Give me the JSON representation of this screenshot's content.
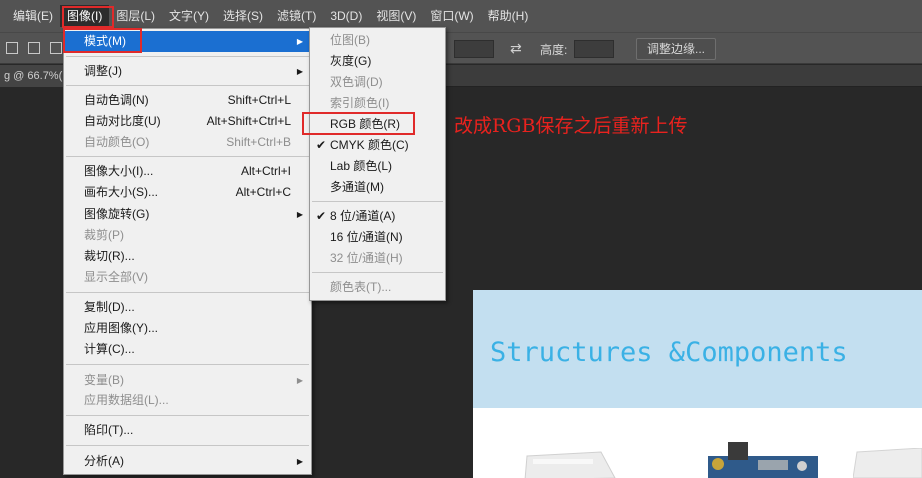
{
  "menubar": {
    "items": [
      "编辑(E)",
      "图像(I)",
      "图层(L)",
      "文字(Y)",
      "选择(S)",
      "滤镜(T)",
      "3D(D)",
      "视图(V)",
      "窗口(W)",
      "帮助(H)"
    ],
    "active_index": 1
  },
  "options_bar": {
    "height_label": "高度:",
    "refine_edge_button": "调整边缘..."
  },
  "document_tab": {
    "label": "g @ 66.7%("
  },
  "image_menu": {
    "items": [
      {
        "type": "item",
        "label": "模式(M)",
        "shortcut": "",
        "submenu": true,
        "disabled": false,
        "highlighted": true
      },
      {
        "type": "sep"
      },
      {
        "type": "item",
        "label": "调整(J)",
        "shortcut": "",
        "submenu": true,
        "disabled": false
      },
      {
        "type": "sep"
      },
      {
        "type": "item",
        "label": "自动色调(N)",
        "shortcut": "Shift+Ctrl+L",
        "submenu": false,
        "disabled": false
      },
      {
        "type": "item",
        "label": "自动对比度(U)",
        "shortcut": "Alt+Shift+Ctrl+L",
        "submenu": false,
        "disabled": false
      },
      {
        "type": "item",
        "label": "自动颜色(O)",
        "shortcut": "Shift+Ctrl+B",
        "submenu": false,
        "disabled": true
      },
      {
        "type": "sep"
      },
      {
        "type": "item",
        "label": "图像大小(I)...",
        "shortcut": "Alt+Ctrl+I",
        "submenu": false,
        "disabled": false
      },
      {
        "type": "item",
        "label": "画布大小(S)...",
        "shortcut": "Alt+Ctrl+C",
        "submenu": false,
        "disabled": false
      },
      {
        "type": "item",
        "label": "图像旋转(G)",
        "shortcut": "",
        "submenu": true,
        "disabled": false
      },
      {
        "type": "item",
        "label": "裁剪(P)",
        "shortcut": "",
        "submenu": false,
        "disabled": true
      },
      {
        "type": "item",
        "label": "裁切(R)...",
        "shortcut": "",
        "submenu": false,
        "disabled": false
      },
      {
        "type": "item",
        "label": "显示全部(V)",
        "shortcut": "",
        "submenu": false,
        "disabled": true
      },
      {
        "type": "sep"
      },
      {
        "type": "item",
        "label": "复制(D)...",
        "shortcut": "",
        "submenu": false,
        "disabled": false
      },
      {
        "type": "item",
        "label": "应用图像(Y)...",
        "shortcut": "",
        "submenu": false,
        "disabled": false
      },
      {
        "type": "item",
        "label": "计算(C)...",
        "shortcut": "",
        "submenu": false,
        "disabled": false
      },
      {
        "type": "sep"
      },
      {
        "type": "item",
        "label": "变量(B)",
        "shortcut": "",
        "submenu": true,
        "disabled": true
      },
      {
        "type": "item",
        "label": "应用数据组(L)...",
        "shortcut": "",
        "submenu": false,
        "disabled": true
      },
      {
        "type": "sep"
      },
      {
        "type": "item",
        "label": "陷印(T)...",
        "shortcut": "",
        "submenu": false,
        "disabled": false
      },
      {
        "type": "sep"
      },
      {
        "type": "item",
        "label": "分析(A)",
        "shortcut": "",
        "submenu": true,
        "disabled": false
      }
    ]
  },
  "mode_submenu": {
    "items": [
      {
        "type": "item",
        "label": "位图(B)",
        "disabled": true,
        "checked": false
      },
      {
        "type": "item",
        "label": "灰度(G)",
        "disabled": false,
        "checked": false
      },
      {
        "type": "item",
        "label": "双色调(D)",
        "disabled": true,
        "checked": false
      },
      {
        "type": "item",
        "label": "索引颜色(I)",
        "disabled": true,
        "checked": false
      },
      {
        "type": "item",
        "label": "RGB 颜色(R)",
        "disabled": false,
        "checked": false
      },
      {
        "type": "item",
        "label": "CMYK 颜色(C)",
        "disabled": false,
        "checked": true
      },
      {
        "type": "item",
        "label": "Lab 颜色(L)",
        "disabled": false,
        "checked": false
      },
      {
        "type": "item",
        "label": "多通道(M)",
        "disabled": false,
        "checked": false
      },
      {
        "type": "sep"
      },
      {
        "type": "item",
        "label": "8 位/通道(A)",
        "disabled": false,
        "checked": true
      },
      {
        "type": "item",
        "label": "16 位/通道(N)",
        "disabled": false,
        "checked": false
      },
      {
        "type": "item",
        "label": "32 位/通道(H)",
        "disabled": true,
        "checked": false
      },
      {
        "type": "sep"
      },
      {
        "type": "item",
        "label": "颜色表(T)...",
        "disabled": true,
        "checked": false
      }
    ]
  },
  "annotation": {
    "text": "改成RGB保存之后重新上传"
  },
  "document": {
    "heading": "Structures &Components"
  },
  "colors": {
    "accent_highlight": "#1b6fd1",
    "annotation_red": "#e02a2a",
    "heading_blue": "#3ab1e5",
    "banner_bg": "#c3dff0"
  }
}
